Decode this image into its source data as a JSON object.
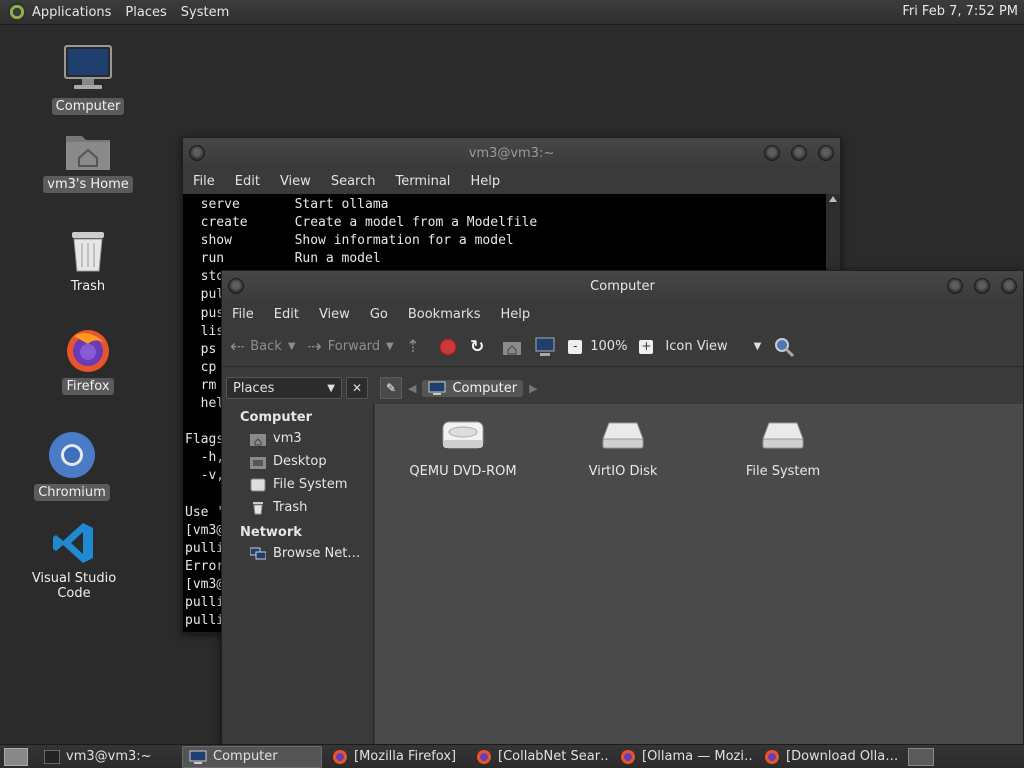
{
  "top_panel": {
    "menus": [
      "Applications",
      "Places",
      "System"
    ],
    "clock": "Fri Feb  7, 7:52 PM"
  },
  "desktop": {
    "icons": [
      {
        "label": "Computer"
      },
      {
        "label": "vm3's Home"
      },
      {
        "label": "Trash"
      },
      {
        "label": "Firefox"
      },
      {
        "label": "Chromium"
      },
      {
        "label": "Visual Studio Code"
      }
    ]
  },
  "terminal": {
    "title": "vm3@vm3:~",
    "menus": [
      "File",
      "Edit",
      "View",
      "Search",
      "Terminal",
      "Help"
    ],
    "lines": [
      "  serve       Start ollama",
      "  create      Create a model from a Modelfile",
      "  show        Show information for a model",
      "  run         Run a model",
      "  sto",
      "  pul",
      "  pus",
      "  lis",
      "  ps",
      "  cp",
      "  rm",
      "  hel",
      "",
      "Flags",
      "  -h,",
      "  -v,",
      "",
      "Use '",
      "[vm3@",
      "pulli",
      "Error",
      "[vm3@",
      "pulli",
      "pulli"
    ]
  },
  "file_manager": {
    "title": "Computer",
    "menus": [
      "File",
      "Edit",
      "View",
      "Go",
      "Bookmarks",
      "Help"
    ],
    "toolbar": {
      "back": "Back",
      "forward": "Forward",
      "zoom": "100%",
      "view_mode": "Icon View"
    },
    "side_pane": {
      "selector": "Places",
      "close": "✕",
      "sections": [
        {
          "heading": "Computer",
          "items": [
            "vm3",
            "Desktop",
            "File System",
            "Trash"
          ]
        },
        {
          "heading": "Network",
          "items": [
            "Browse Net…"
          ]
        }
      ]
    },
    "location": "Computer",
    "items": [
      {
        "label": "QEMU DVD-ROM",
        "icon": "optical-drive-icon"
      },
      {
        "label": "VirtIO Disk",
        "icon": "hard-disk-icon"
      },
      {
        "label": "File System",
        "icon": "hard-disk-icon"
      }
    ]
  },
  "taskbar": {
    "tasks": [
      {
        "label": "vm3@vm3:~",
        "icon": "terminal-icon",
        "active": false
      },
      {
        "label": "Computer",
        "icon": "computer-icon",
        "active": true
      },
      {
        "label": "[Mozilla Firefox]",
        "icon": "firefox-icon",
        "active": false
      },
      {
        "label": "[CollabNet Sear…",
        "icon": "firefox-icon",
        "active": false
      },
      {
        "label": "[Ollama — Mozi…",
        "icon": "firefox-icon",
        "active": false
      },
      {
        "label": "[Download Olla…",
        "icon": "firefox-icon",
        "active": false
      }
    ]
  },
  "colors": {
    "desktop_bg": "#2b2b2b",
    "panel_bg": "#3a3a3a",
    "terminal_bg": "#000000",
    "selection": "#555555"
  }
}
